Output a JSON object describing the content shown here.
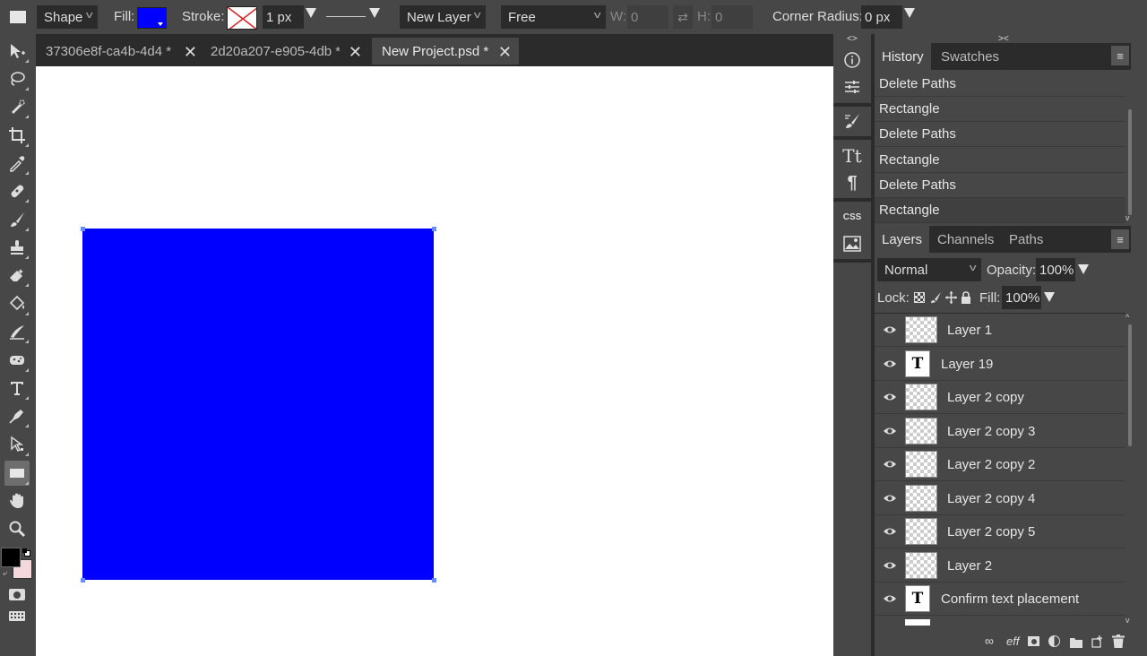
{
  "options_bar": {
    "tool_mode": "Shape",
    "fill_label": "Fill:",
    "fill_color": "#0000ff",
    "stroke_label": "Stroke:",
    "stroke_width": "1 px",
    "layer_target": "New Layer",
    "constraint": "Free",
    "w_label": "W:",
    "w_value": "0",
    "h_label": "H:",
    "h_value": "0",
    "corner_radius_label": "Corner Radius:",
    "corner_radius_value": "0 px"
  },
  "tabs": [
    {
      "label": "37306e8f-ca4b-4d4 *"
    },
    {
      "label": "2d20a207-e905-4db *"
    },
    {
      "label": "New Project.psd *"
    }
  ],
  "canvas": {
    "background": "#ffffff",
    "shape_color": "#0000ff"
  },
  "side_strip": {
    "css_label": "CSS"
  },
  "history_panel": {
    "tabs": [
      "History",
      "Swatches"
    ],
    "items": [
      "Delete Paths",
      "Rectangle",
      "Delete Paths",
      "Rectangle",
      "Delete Paths",
      "Rectangle"
    ]
  },
  "layers_panel": {
    "tabs": [
      "Layers",
      "Channels",
      "Paths"
    ],
    "blend_mode": "Normal",
    "opacity_label": "Opacity:",
    "opacity_value": "100%",
    "lock_label": "Lock:",
    "fill_label": "Fill:",
    "fill_value": "100%",
    "text_thumb_glyph": "T",
    "layers": [
      {
        "name": "Layer 1",
        "type": "raster"
      },
      {
        "name": "Layer 19",
        "type": "text"
      },
      {
        "name": "Layer 2 copy",
        "type": "raster"
      },
      {
        "name": "Layer 2 copy 3",
        "type": "raster"
      },
      {
        "name": "Layer 2 copy 2",
        "type": "raster"
      },
      {
        "name": "Layer 2 copy 4",
        "type": "raster"
      },
      {
        "name": "Layer 2 copy 5",
        "type": "raster"
      },
      {
        "name": "Layer 2",
        "type": "raster"
      },
      {
        "name": "Confirm text placement",
        "type": "text"
      }
    ],
    "footer_eff_label": "eff"
  },
  "colors": {
    "foreground": "#000000",
    "background": "#f5d8dc"
  }
}
